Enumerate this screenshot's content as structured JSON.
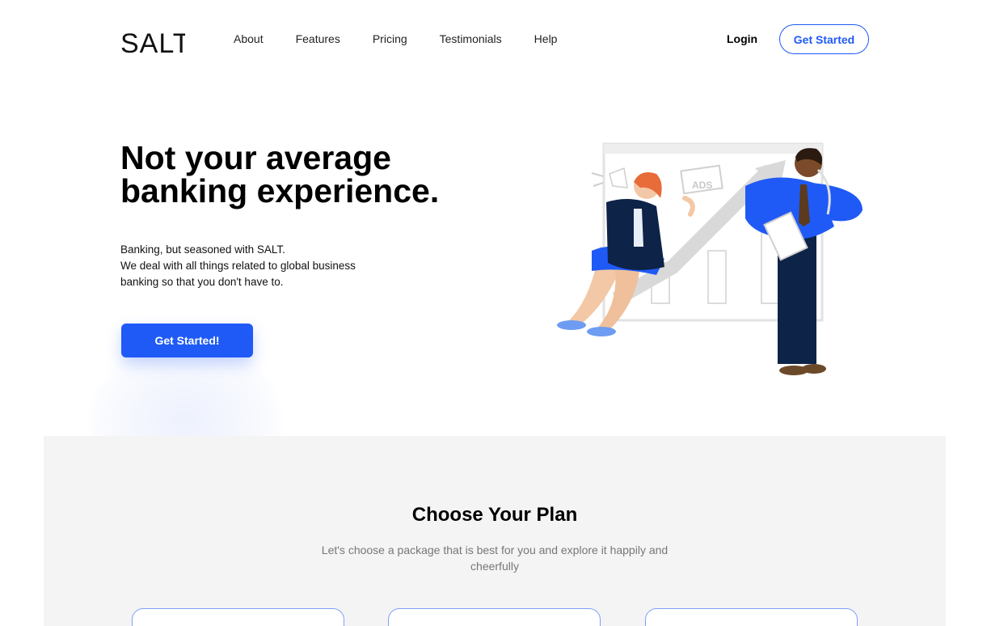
{
  "brand": {
    "logo_text": "SALT"
  },
  "nav": {
    "links": [
      {
        "label": "About"
      },
      {
        "label": "Features"
      },
      {
        "label": "Pricing"
      },
      {
        "label": "Testimonials"
      },
      {
        "label": "Help"
      }
    ],
    "login_label": "Login",
    "get_started_label": "Get Started"
  },
  "hero": {
    "title_line1": "Not your average",
    "title_line2": "banking experience.",
    "sub_line1": "Banking, but seasoned with SALT.",
    "sub_line2": "We deal with all things related to global business",
    "sub_line3": "banking so that you don't have to.",
    "cta_label": "Get Started!",
    "illustration_badge": "ADS"
  },
  "plans": {
    "title": "Choose Your Plan",
    "subtitle": "Let's choose a package that is best for you and explore it happily and cheerfully"
  },
  "colors": {
    "accent": "#1f5af6",
    "section_bg": "#f4f4f5",
    "navy": "#0d2347"
  }
}
